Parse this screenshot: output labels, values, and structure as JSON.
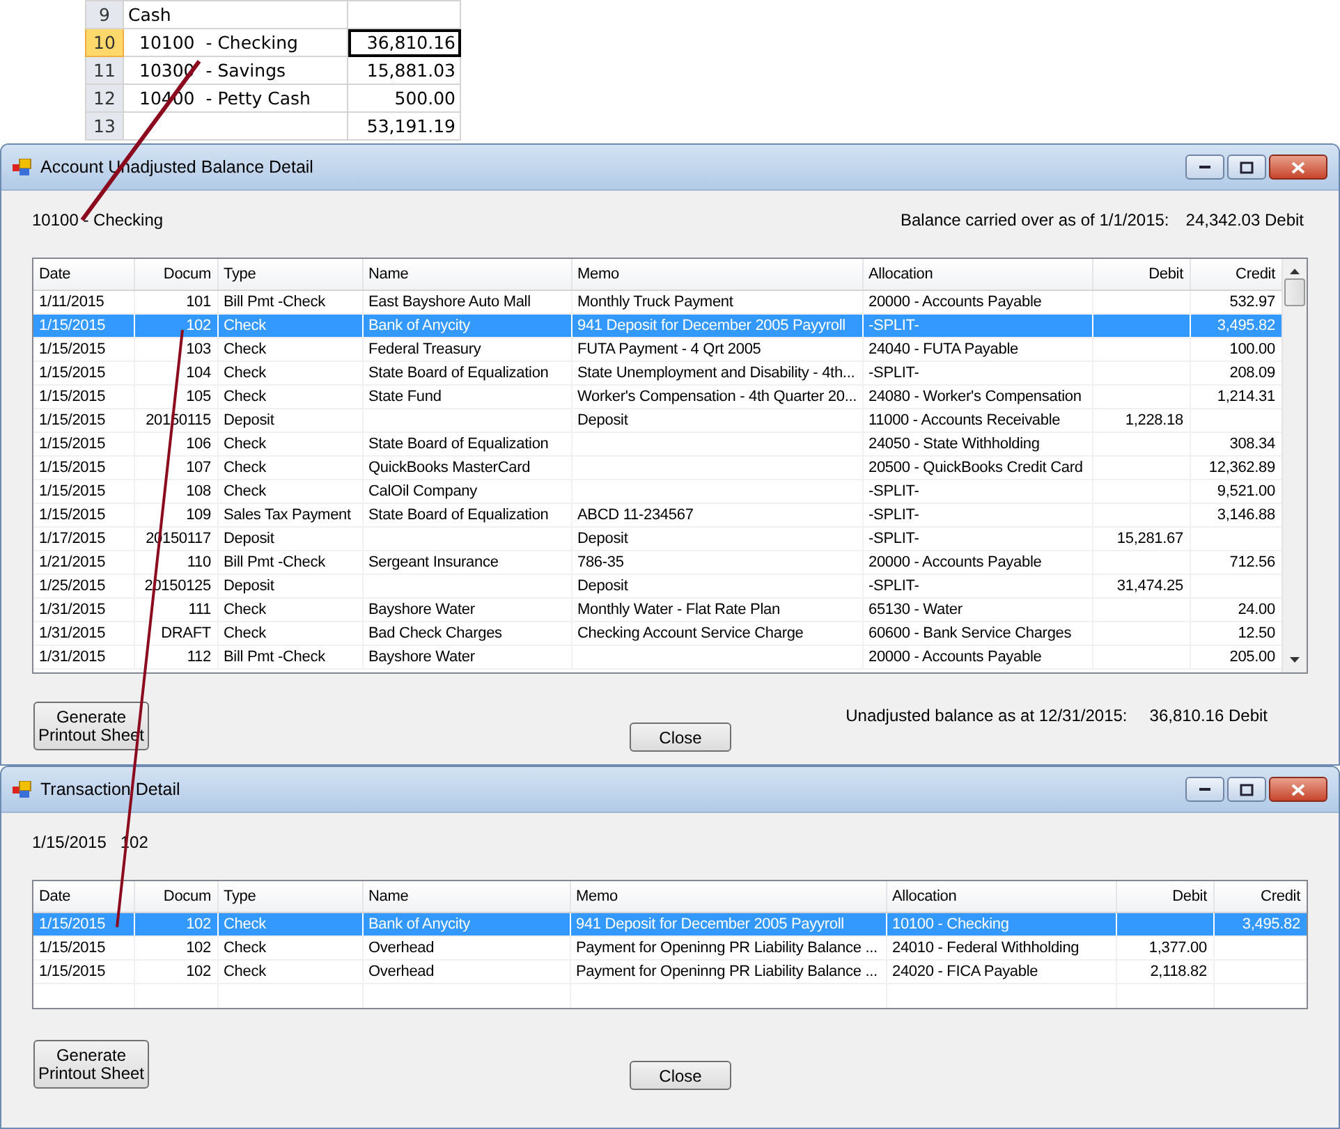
{
  "spreadsheet": {
    "rows": [
      {
        "number": "9",
        "label": "Cash",
        "kind": "heading",
        "selected": false
      },
      {
        "number": "10",
        "label": "10100  - Checking",
        "amount": "36,810.16",
        "kind": "item",
        "selected": true
      },
      {
        "number": "11",
        "label": "10300  - Savings",
        "amount": "15,881.03",
        "kind": "item",
        "selected": false
      },
      {
        "number": "12",
        "label": "10400  - Petty Cash",
        "amount": "500.00",
        "kind": "item",
        "selected": false
      },
      {
        "number": "13",
        "amount": "53,191.19",
        "kind": "total",
        "selected": false
      }
    ]
  },
  "windows": [
    {
      "title": "Account Unadjusted Balance Detail",
      "subject": "10100 - Checking",
      "balance_label": "Balance carried over as of 1/1/2015:",
      "balance_value": "24,342.03 Debit",
      "columns": [
        "Date",
        "Docum",
        "Type",
        "Name",
        "Memo",
        "Allocation",
        "Debit",
        "Credit"
      ],
      "rows": [
        {
          "date": "1/11/2015",
          "doc": "101",
          "type": "Bill Pmt -Check",
          "name": "East Bayshore Auto Mall",
          "memo": "Monthly Truck Payment",
          "allocation": "20000 - Accounts Payable",
          "credit": "532.97",
          "selected": false
        },
        {
          "date": "1/15/2015",
          "doc": "102",
          "type": "Check",
          "name": "Bank of Anycity",
          "memo": "941 Deposit for December 2005 Payyroll",
          "allocation": "-SPLIT-",
          "credit": "3,495.82",
          "selected": true
        },
        {
          "date": "1/15/2015",
          "doc": "103",
          "type": "Check",
          "name": "Federal Treasury",
          "memo": "FUTA Payment - 4 Qrt 2005",
          "allocation": "24040 - FUTA Payable",
          "credit": "100.00",
          "selected": false
        },
        {
          "date": "1/15/2015",
          "doc": "104",
          "type": "Check",
          "name": "State Board of Equalization",
          "memo": "State Unemployment and Disability - 4th...",
          "allocation": "-SPLIT-",
          "credit": "208.09",
          "selected": false
        },
        {
          "date": "1/15/2015",
          "doc": "105",
          "type": "Check",
          "name": "State Fund",
          "memo": "Worker's Compensation - 4th Quarter 20...",
          "allocation": "24080 - Worker's Compensation",
          "credit": "1,214.31",
          "selected": false
        },
        {
          "date": "1/15/2015",
          "doc": "20150115",
          "type": "Deposit",
          "memo": "Deposit",
          "allocation": "11000 - Accounts Receivable",
          "debit": "1,228.18",
          "selected": false
        },
        {
          "date": "1/15/2015",
          "doc": "106",
          "type": "Check",
          "name": "State Board of Equalization",
          "allocation": "24050 - State Withholding",
          "credit": "308.34",
          "selected": false
        },
        {
          "date": "1/15/2015",
          "doc": "107",
          "type": "Check",
          "name": "QuickBooks MasterCard",
          "allocation": "20500 - QuickBooks Credit Card",
          "credit": "12,362.89",
          "selected": false
        },
        {
          "date": "1/15/2015",
          "doc": "108",
          "type": "Check",
          "name": "CalOil Company",
          "allocation": "-SPLIT-",
          "credit": "9,521.00",
          "selected": false
        },
        {
          "date": "1/15/2015",
          "doc": "109",
          "type": "Sales Tax Payment",
          "name": "State Board of Equalization",
          "memo": "ABCD 11-234567",
          "allocation": "-SPLIT-",
          "credit": "3,146.88",
          "selected": false
        },
        {
          "date": "1/17/2015",
          "doc": "20150117",
          "type": "Deposit",
          "memo": "Deposit",
          "allocation": "-SPLIT-",
          "debit": "15,281.67",
          "selected": false
        },
        {
          "date": "1/21/2015",
          "doc": "110",
          "type": "Bill Pmt -Check",
          "name": "Sergeant Insurance",
          "memo": "786-35",
          "allocation": "20000 - Accounts Payable",
          "credit": "712.56",
          "selected": false
        },
        {
          "date": "1/25/2015",
          "doc": "20150125",
          "type": "Deposit",
          "memo": "Deposit",
          "allocation": "-SPLIT-",
          "debit": "31,474.25",
          "selected": false
        },
        {
          "date": "1/31/2015",
          "doc": "111",
          "type": "Check",
          "name": "Bayshore Water",
          "memo": "Monthly Water - Flat Rate Plan",
          "allocation": "65130 - Water",
          "credit": "24.00",
          "selected": false
        },
        {
          "date": "1/31/2015",
          "doc": "DRAFT",
          "type": "Check",
          "name": "Bad Check Charges",
          "memo": "Checking Account Service Charge",
          "allocation": "60600 - Bank Service Charges",
          "credit": "12.50",
          "selected": false
        },
        {
          "date": "1/31/2015",
          "doc": "112",
          "type": "Bill Pmt -Check",
          "name": "Bayshore Water",
          "allocation": "20000 - Accounts Payable",
          "credit": "205.00",
          "selected": false
        }
      ],
      "footer_label": "Unadjusted balance as at 12/31/2015:",
      "footer_value": "36,810.16 Debit",
      "generate_button": "Generate\nPrintout Sheet",
      "close_button": "Close"
    },
    {
      "title": "Transaction Detail",
      "subject": "1/15/2015   102",
      "columns": [
        "Date",
        "Docum",
        "Type",
        "Name",
        "Memo",
        "Allocation",
        "Debit",
        "Credit"
      ],
      "rows": [
        {
          "date": "1/15/2015",
          "doc": "102",
          "type": "Check",
          "name": "Bank of Anycity",
          "memo": "941 Deposit for December 2005 Payyroll",
          "allocation": "10100 - Checking",
          "credit": "3,495.82",
          "selected": true
        },
        {
          "date": "1/15/2015",
          "doc": "102",
          "type": "Check",
          "name": "Overhead",
          "memo": "Payment for Openinng PR Liability Balance ...",
          "allocation": "24010 - Federal Withholding",
          "debit": "1,377.00",
          "selected": false
        },
        {
          "date": "1/15/2015",
          "doc": "102",
          "type": "Check",
          "name": "Overhead",
          "memo": "Payment for Openinng PR Liability Balance ...",
          "allocation": "24020 - FICA Payable",
          "debit": "2,118.82",
          "selected": false
        }
      ],
      "generate_button": "Generate\nPrintout Sheet",
      "close_button": "Close"
    }
  ]
}
